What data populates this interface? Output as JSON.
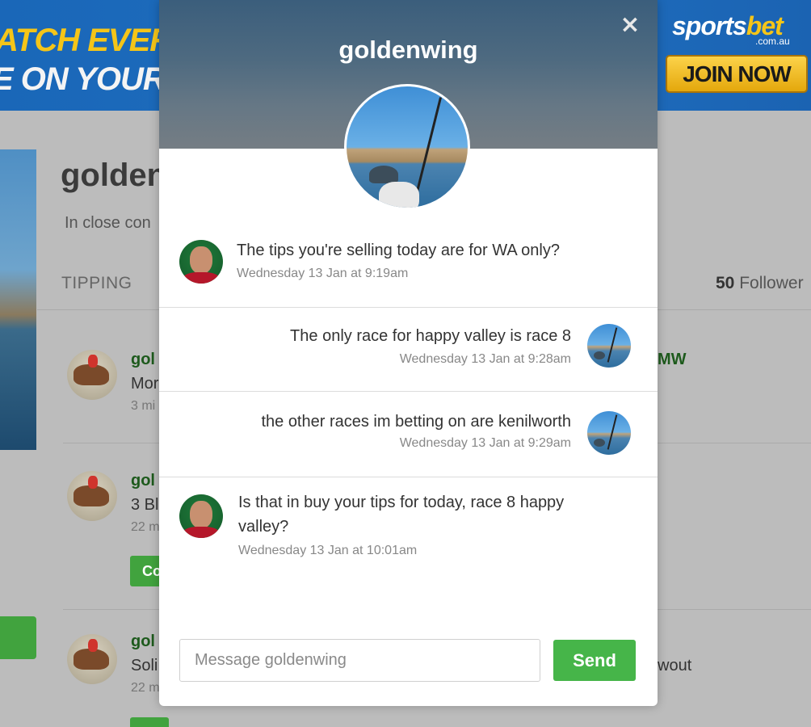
{
  "banner": {
    "headline_line1": "ATCH EVERY",
    "headline_line2": "E ON YOUR",
    "brand_sports": "sports",
    "brand_bet": "bet",
    "brand_domain": ".com.au",
    "cta": "JOIN NOW"
  },
  "background": {
    "profile_name": "golden",
    "bio": "In close con",
    "tab": "TIPPING",
    "followers_count": "50",
    "followers_label": "Follower",
    "feed": [
      {
        "name": "gol",
        "text": "Mor",
        "time": "3 mi",
        "right": "MW"
      },
      {
        "name": "gol",
        "text": "3 Bl",
        "time": "22 m",
        "button": "Co"
      },
      {
        "name": "gol",
        "text": "Soli",
        "time": "22 m",
        "right": "wout"
      }
    ]
  },
  "modal": {
    "title": "goldenwing",
    "close_glyph": "×",
    "messages": [
      {
        "side": "left",
        "avatar": "user-man-avatar",
        "text": "The tips you're selling today are for WA only?",
        "time": "Wednesday 13 Jan at 9:19am"
      },
      {
        "side": "right",
        "avatar": "goldenwing-avatar",
        "text": "The only race for happy valley is race 8",
        "time": "Wednesday 13 Jan at 9:28am"
      },
      {
        "side": "right",
        "avatar": "goldenwing-avatar",
        "text": "the other races im betting on are kenilworth",
        "time": "Wednesday 13 Jan at 9:29am"
      },
      {
        "side": "left",
        "avatar": "user-man-avatar",
        "text": "Is that in buy your tips for today, race 8 happy valley?",
        "time": "Wednesday 13 Jan at 10:01am"
      }
    ],
    "composer": {
      "placeholder": "Message goldenwing",
      "value": "",
      "send_label": "Send"
    }
  },
  "colors": {
    "accent_green": "#46b549",
    "username_green": "#1d5a1c",
    "banner_blue": "#1a67b8",
    "banner_yellow": "#f5c518"
  }
}
